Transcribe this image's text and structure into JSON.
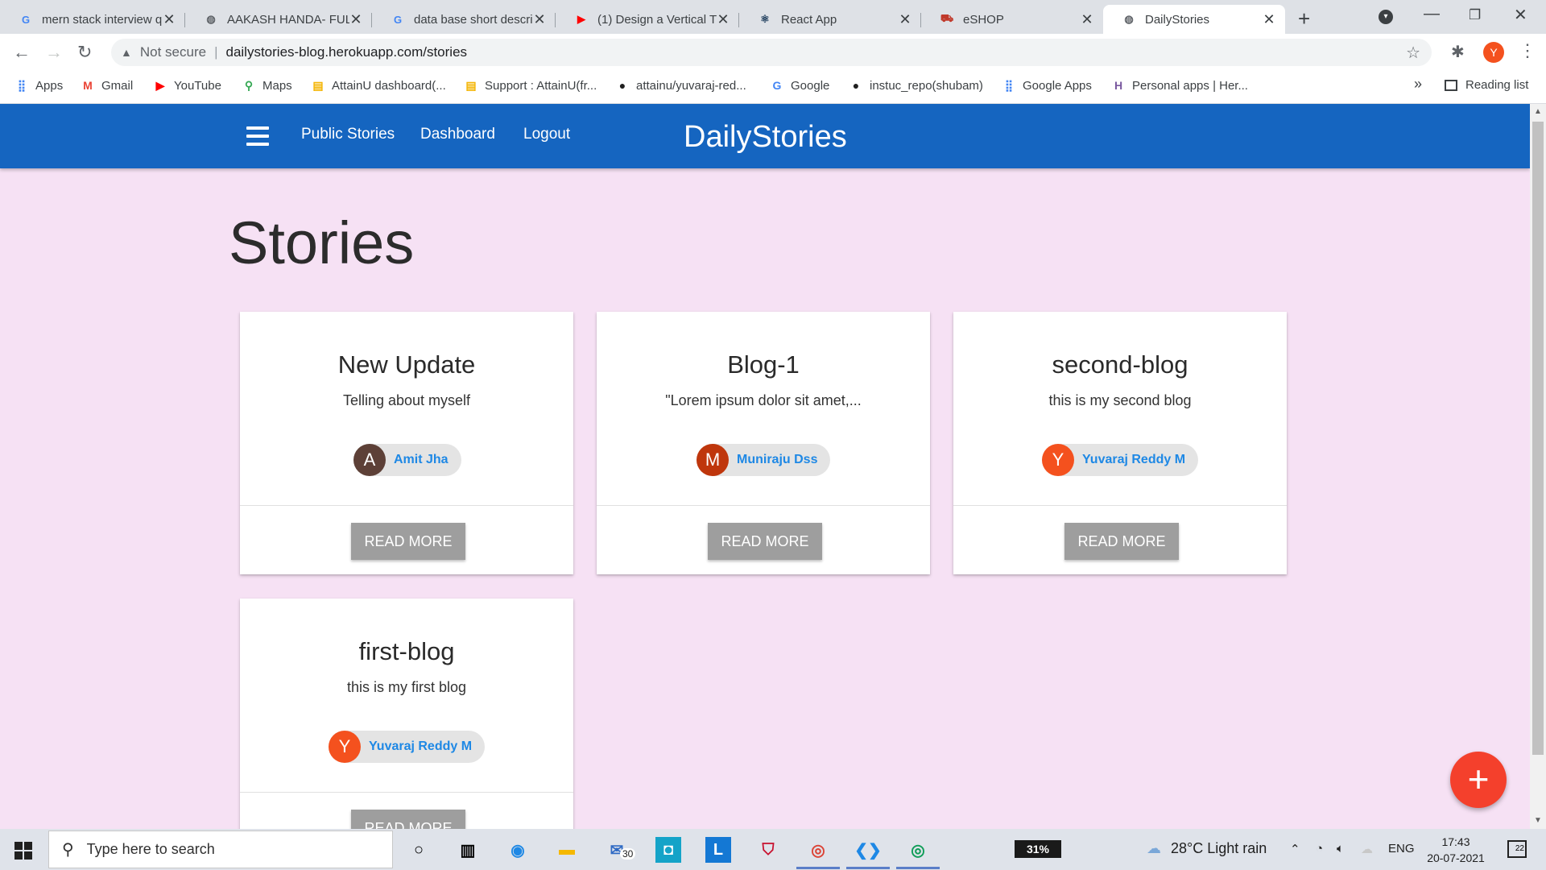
{
  "browser": {
    "tabs": [
      {
        "title": "mern stack interview q",
        "favicon": "G"
      },
      {
        "title": "AAKASH HANDA- FULL",
        "favicon": "globe"
      },
      {
        "title": "data base short descri",
        "favicon": "G"
      },
      {
        "title": "(1) Design a Vertical T",
        "favicon": "youtube"
      },
      {
        "title": "React App",
        "favicon": "react"
      },
      {
        "title": "eSHOP",
        "favicon": "cart"
      },
      {
        "title": "DailyStories",
        "favicon": "globe",
        "active": true
      }
    ],
    "profile_initial": "Y",
    "address": {
      "security_label": "Not secure",
      "url": "dailystories-blog.herokuapp.com/stories"
    },
    "bookmarks": [
      {
        "label": "Apps",
        "icon": "apps-grid-icon"
      },
      {
        "label": "Gmail",
        "icon": "gmail-icon"
      },
      {
        "label": "YouTube",
        "icon": "youtube-icon"
      },
      {
        "label": "Maps",
        "icon": "maps-icon"
      },
      {
        "label": "AttainU dashboard(...",
        "icon": "attainu-icon"
      },
      {
        "label": "Support : AttainU(fr...",
        "icon": "attainu-icon"
      },
      {
        "label": "attainu/yuvaraj-red...",
        "icon": "github-icon"
      },
      {
        "label": "Google",
        "icon": "google-icon"
      },
      {
        "label": "instuc_repo(shubam)",
        "icon": "github-icon"
      },
      {
        "label": "Google Apps",
        "icon": "apps-grid-icon"
      },
      {
        "label": "Personal apps | Her...",
        "icon": "heroku-icon"
      }
    ],
    "bookmarks_more": "»",
    "reading_list": "Reading list"
  },
  "app": {
    "brand": "DailyStories",
    "nav": [
      "Public Stories",
      "Dashboard",
      "Logout"
    ],
    "page_title": "Stories",
    "colors": {
      "appbar": "#1565c0",
      "background": "#f6e1f4",
      "fab": "#f4402c",
      "author_link": "#1e88e5"
    },
    "stories": [
      {
        "title": "New Update",
        "excerpt": "Telling about myself",
        "author": "Amit Jha",
        "initial": "A",
        "avatar_color": "#5d4037",
        "button": "READ MORE"
      },
      {
        "title": "Blog-1",
        "excerpt": "\"Lorem ipsum dolor sit amet,...",
        "author": "Muniraju Dss",
        "initial": "M",
        "avatar_color": "#bf360c",
        "button": "READ MORE"
      },
      {
        "title": "second-blog",
        "excerpt": "this is my second blog",
        "author": "Yuvaraj Reddy M",
        "initial": "Y",
        "avatar_color": "#f4511e",
        "button": "READ MORE"
      },
      {
        "title": "first-blog",
        "excerpt": "this is my first blog",
        "author": "Yuvaraj Reddy M",
        "initial": "Y",
        "avatar_color": "#f4511e",
        "button": "READ MORE"
      }
    ],
    "fab_label": "+"
  },
  "taskbar": {
    "search_placeholder": "Type here to search",
    "mail_badge": "30",
    "battery": "31%",
    "weather": "28°C  Light rain",
    "language": "ENG",
    "time": "17:43",
    "date": "20-07-2021",
    "notifications": "22"
  }
}
